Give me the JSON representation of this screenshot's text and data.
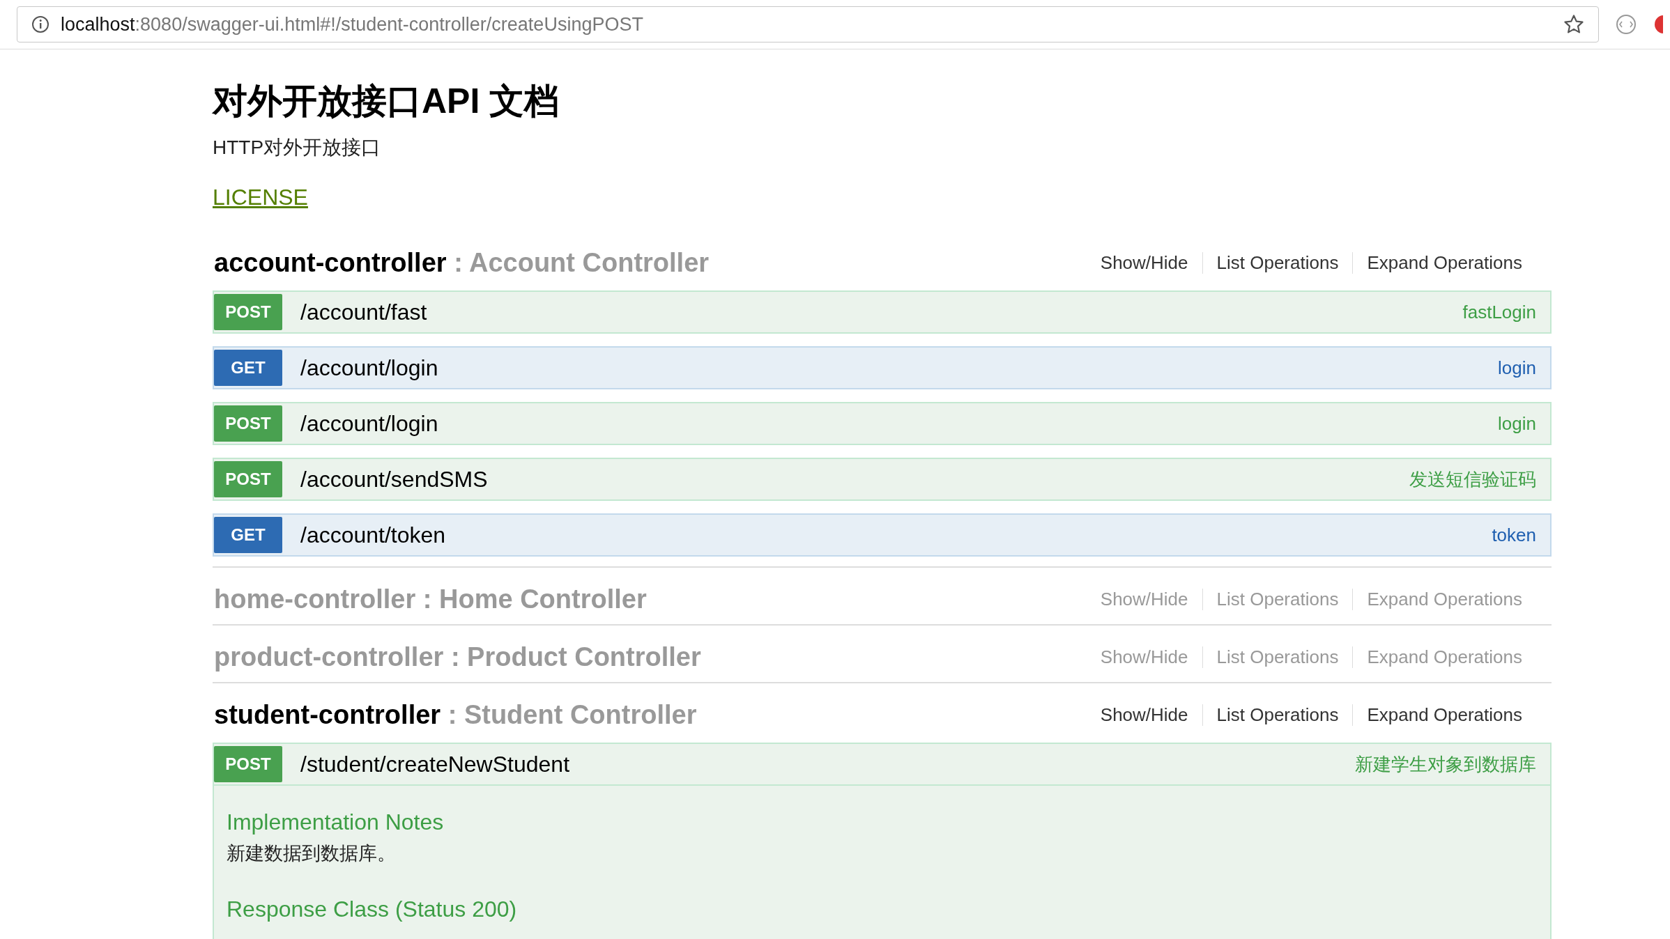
{
  "browser": {
    "url_host": "localhost",
    "url_rest": ":8080/swagger-ui.html#!/student-controller/createUsingPOST"
  },
  "info": {
    "title": "对外开放接口API 文档",
    "description": "HTTP对外开放接口",
    "license": "LICENSE"
  },
  "resources": [
    {
      "name": "account-controller",
      "description": ": Account Controller",
      "active": true,
      "links": [
        "Show/Hide",
        "List Operations",
        "Expand Operations"
      ],
      "operations": [
        {
          "kind": "post",
          "method": "POST",
          "path": "/account/fast",
          "summary": "fastLogin",
          "expanded": false
        },
        {
          "kind": "get",
          "method": "GET",
          "path": "/account/login",
          "summary": "login",
          "expanded": false
        },
        {
          "kind": "post",
          "method": "POST",
          "path": "/account/login",
          "summary": "login",
          "expanded": false
        },
        {
          "kind": "post",
          "method": "POST",
          "path": "/account/sendSMS",
          "summary": "发送短信验证码",
          "expanded": false
        },
        {
          "kind": "get",
          "method": "GET",
          "path": "/account/token",
          "summary": "token",
          "expanded": false
        }
      ]
    },
    {
      "name": "home-controller",
      "description": ": Home Controller",
      "active": false,
      "links": [
        "Show/Hide",
        "List Operations",
        "Expand Operations"
      ]
    },
    {
      "name": "product-controller",
      "description": ": Product Controller",
      "active": false,
      "links": [
        "Show/Hide",
        "List Operations",
        "Expand Operations"
      ]
    },
    {
      "name": "student-controller",
      "description": ": Student Controller",
      "active": true,
      "links": [
        "Show/Hide",
        "List Operations",
        "Expand Operations"
      ],
      "operations": [
        {
          "kind": "post",
          "method": "POST",
          "path": "/student/createNewStudent",
          "summary": "新建学生对象到数据库",
          "expanded": true,
          "notes_heading": "Implementation Notes",
          "notes": "新建数据到数据库。",
          "response_heading": "Response Class (Status 200)"
        }
      ]
    }
  ]
}
